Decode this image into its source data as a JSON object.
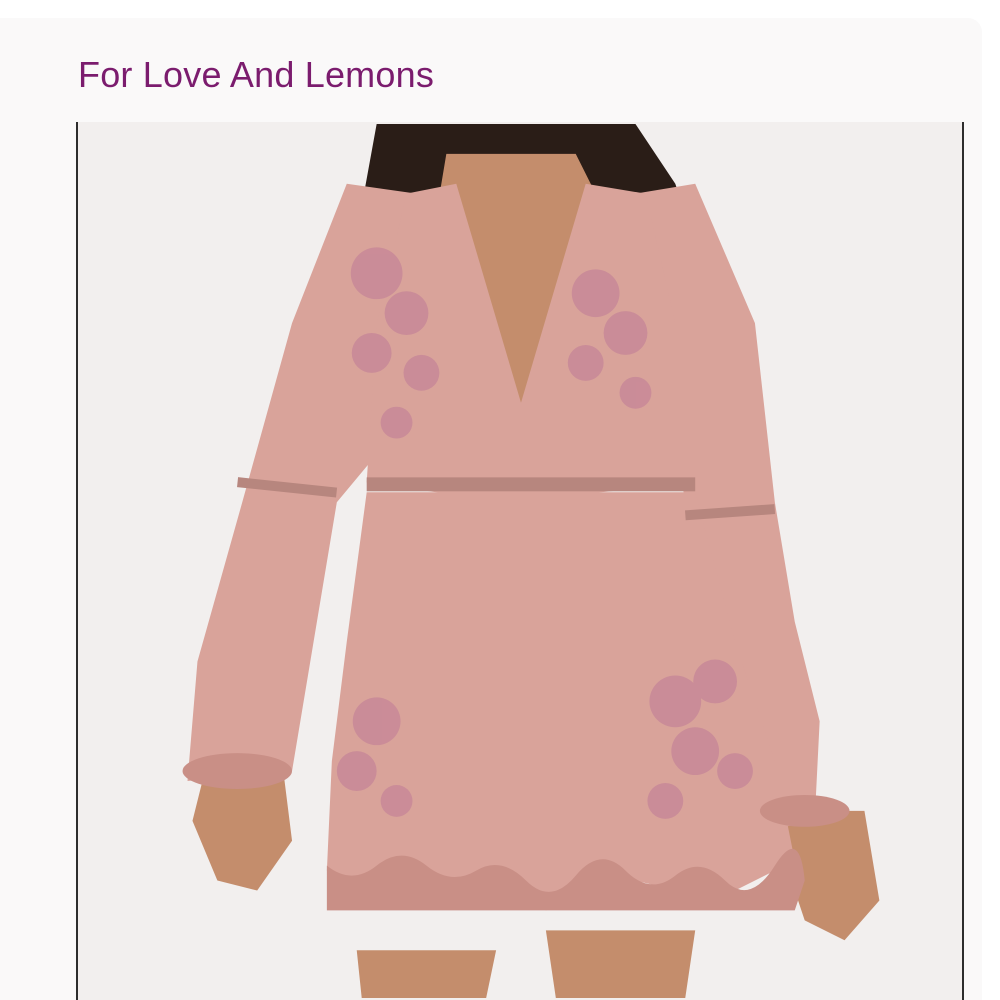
{
  "product": {
    "brand": "For Love And Lemons",
    "image": {
      "icon": "product-photo",
      "colors": {
        "background": "#f2efee",
        "garment": "#d9a39a",
        "garment_shadow": "#c98f86",
        "lace": "#c98a98",
        "skin": "#c48d6c",
        "hair": "#2a1d17"
      }
    }
  }
}
